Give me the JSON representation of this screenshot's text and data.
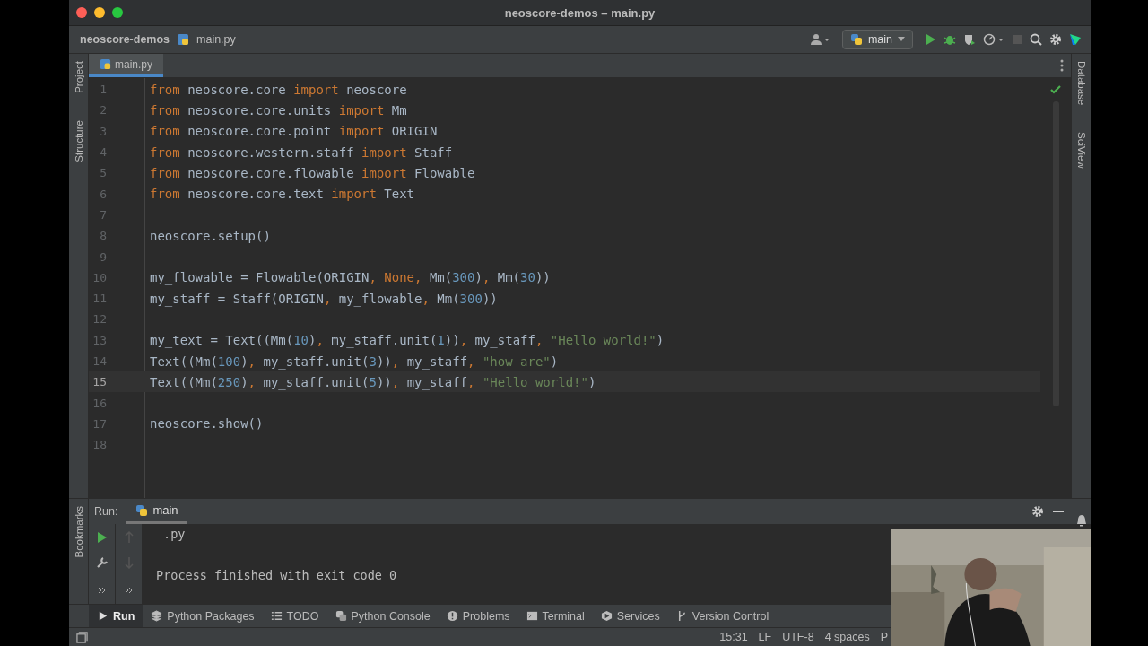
{
  "window": {
    "title": "neoscore-demos – main.py"
  },
  "breadcrumb": {
    "project": "neoscore-demos",
    "file": "main.py"
  },
  "run_config": {
    "label": "main"
  },
  "editor_tabs": [
    {
      "label": "main.py",
      "selected": true
    }
  ],
  "left_stripe": [
    "Project",
    "Structure"
  ],
  "right_stripe": [
    "Database",
    "SciView"
  ],
  "code_lines": [
    {
      "number": "1",
      "current": false,
      "tokens": [
        {
          "kind": "keyword",
          "text": "from"
        },
        {
          "kind": "name",
          "text": " neoscore.core "
        },
        {
          "kind": "keyword",
          "text": "import"
        },
        {
          "kind": "name",
          "text": " neoscore"
        }
      ]
    },
    {
      "number": "2",
      "current": false,
      "tokens": [
        {
          "kind": "keyword",
          "text": "from"
        },
        {
          "kind": "name",
          "text": " neoscore.core.units "
        },
        {
          "kind": "keyword",
          "text": "import"
        },
        {
          "kind": "name",
          "text": " Mm"
        }
      ]
    },
    {
      "number": "3",
      "current": false,
      "tokens": [
        {
          "kind": "keyword",
          "text": "from"
        },
        {
          "kind": "name",
          "text": " neoscore.core.point "
        },
        {
          "kind": "keyword",
          "text": "import"
        },
        {
          "kind": "name",
          "text": " ORIGIN"
        }
      ]
    },
    {
      "number": "4",
      "current": false,
      "tokens": [
        {
          "kind": "keyword",
          "text": "from"
        },
        {
          "kind": "name",
          "text": " neoscore.western.staff "
        },
        {
          "kind": "keyword",
          "text": "import"
        },
        {
          "kind": "name",
          "text": " Staff"
        }
      ]
    },
    {
      "number": "5",
      "current": false,
      "tokens": [
        {
          "kind": "keyword",
          "text": "from"
        },
        {
          "kind": "name",
          "text": " neoscore.core.flowable "
        },
        {
          "kind": "keyword",
          "text": "import"
        },
        {
          "kind": "name",
          "text": " Flowable"
        }
      ]
    },
    {
      "number": "6",
      "current": false,
      "tokens": [
        {
          "kind": "keyword",
          "text": "from"
        },
        {
          "kind": "name",
          "text": " neoscore.core.text "
        },
        {
          "kind": "keyword",
          "text": "import"
        },
        {
          "kind": "name",
          "text": " Text"
        }
      ]
    },
    {
      "number": "7",
      "current": false
    },
    {
      "number": "8",
      "current": false,
      "tokens": [
        {
          "kind": "name",
          "text": "neoscore.setup()"
        }
      ]
    },
    {
      "number": "9",
      "current": false
    },
    {
      "number": "10",
      "current": false,
      "tokens": [
        {
          "kind": "name",
          "text": "my_flowable = Flowable(ORIGIN"
        },
        {
          "kind": "keyword",
          "text": ", None, "
        },
        {
          "kind": "name",
          "text": "Mm("
        },
        {
          "kind": "number",
          "text": "300"
        },
        {
          "kind": "name",
          "text": ")"
        },
        {
          "kind": "keyword",
          "text": ", "
        },
        {
          "kind": "name",
          "text": "Mm("
        },
        {
          "kind": "number",
          "text": "30"
        },
        {
          "kind": "name",
          "text": "))"
        }
      ]
    },
    {
      "number": "11",
      "current": false,
      "tokens": [
        {
          "kind": "name",
          "text": "my_staff = Staff(ORIGIN"
        },
        {
          "kind": "keyword",
          "text": ", "
        },
        {
          "kind": "name",
          "text": "my_flowable"
        },
        {
          "kind": "keyword",
          "text": ", "
        },
        {
          "kind": "name",
          "text": "Mm("
        },
        {
          "kind": "number",
          "text": "300"
        },
        {
          "kind": "name",
          "text": "))"
        }
      ]
    },
    {
      "number": "12",
      "current": false
    },
    {
      "number": "13",
      "current": false,
      "tokens": [
        {
          "kind": "name",
          "text": "my_text = Text((Mm("
        },
        {
          "kind": "number",
          "text": "10"
        },
        {
          "kind": "name",
          "text": ")"
        },
        {
          "kind": "keyword",
          "text": ", "
        },
        {
          "kind": "name",
          "text": "my_staff.unit("
        },
        {
          "kind": "number",
          "text": "1"
        },
        {
          "kind": "name",
          "text": "))"
        },
        {
          "kind": "keyword",
          "text": ", "
        },
        {
          "kind": "name",
          "text": "my_staff"
        },
        {
          "kind": "keyword",
          "text": ", "
        },
        {
          "kind": "string",
          "text": "\"Hello world!\""
        },
        {
          "kind": "name",
          "text": ")"
        }
      ]
    },
    {
      "number": "14",
      "current": false,
      "tokens": [
        {
          "kind": "name",
          "text": "Text((Mm("
        },
        {
          "kind": "number",
          "text": "100"
        },
        {
          "kind": "name",
          "text": ")"
        },
        {
          "kind": "keyword",
          "text": ", "
        },
        {
          "kind": "name",
          "text": "my_staff.unit("
        },
        {
          "kind": "number",
          "text": "3"
        },
        {
          "kind": "name",
          "text": "))"
        },
        {
          "kind": "keyword",
          "text": ", "
        },
        {
          "kind": "name",
          "text": "my_staff"
        },
        {
          "kind": "keyword",
          "text": ", "
        },
        {
          "kind": "string",
          "text": "\"how are\""
        },
        {
          "kind": "name",
          "text": ")"
        }
      ]
    },
    {
      "number": "15",
      "current": true,
      "tokens": [
        {
          "kind": "name",
          "text": "Text((Mm("
        },
        {
          "kind": "number",
          "text": "250"
        },
        {
          "kind": "name",
          "text": ")"
        },
        {
          "kind": "keyword",
          "text": ", "
        },
        {
          "kind": "name",
          "text": "my_staff.unit("
        },
        {
          "kind": "number",
          "text": "5"
        },
        {
          "kind": "name",
          "text": "))"
        },
        {
          "kind": "keyword",
          "text": ", "
        },
        {
          "kind": "name",
          "text": "my_staff"
        },
        {
          "kind": "keyword",
          "text": ", "
        },
        {
          "kind": "string",
          "text": "\"Hello world!\""
        },
        {
          "kind": "name",
          "text": ")"
        }
      ]
    },
    {
      "number": "16",
      "current": false
    },
    {
      "number": "17",
      "current": false,
      "tokens": [
        {
          "kind": "name",
          "text": "neoscore.show()"
        }
      ]
    },
    {
      "number": "18",
      "current": false
    }
  ],
  "run_panel": {
    "label": "Run:",
    "tabs": [
      {
        "label": "main",
        "selected": true
      }
    ],
    "stripe": [
      "Bookmarks"
    ],
    "output": [
      ".py",
      "Process finished with exit code 0"
    ]
  },
  "tool_tabs": [
    {
      "label": "Run",
      "selected": true
    },
    {
      "label": "Python Packages",
      "selected": false
    },
    {
      "label": "TODO",
      "selected": false
    },
    {
      "label": "Python Console",
      "selected": false
    },
    {
      "label": "Problems",
      "selected": false
    },
    {
      "label": "Terminal",
      "selected": false
    },
    {
      "label": "Services",
      "selected": false
    },
    {
      "label": "Version Control",
      "selected": false
    }
  ],
  "status_bar": [
    "15:31",
    "LF",
    "UTF-8",
    "4 spaces",
    "P"
  ]
}
